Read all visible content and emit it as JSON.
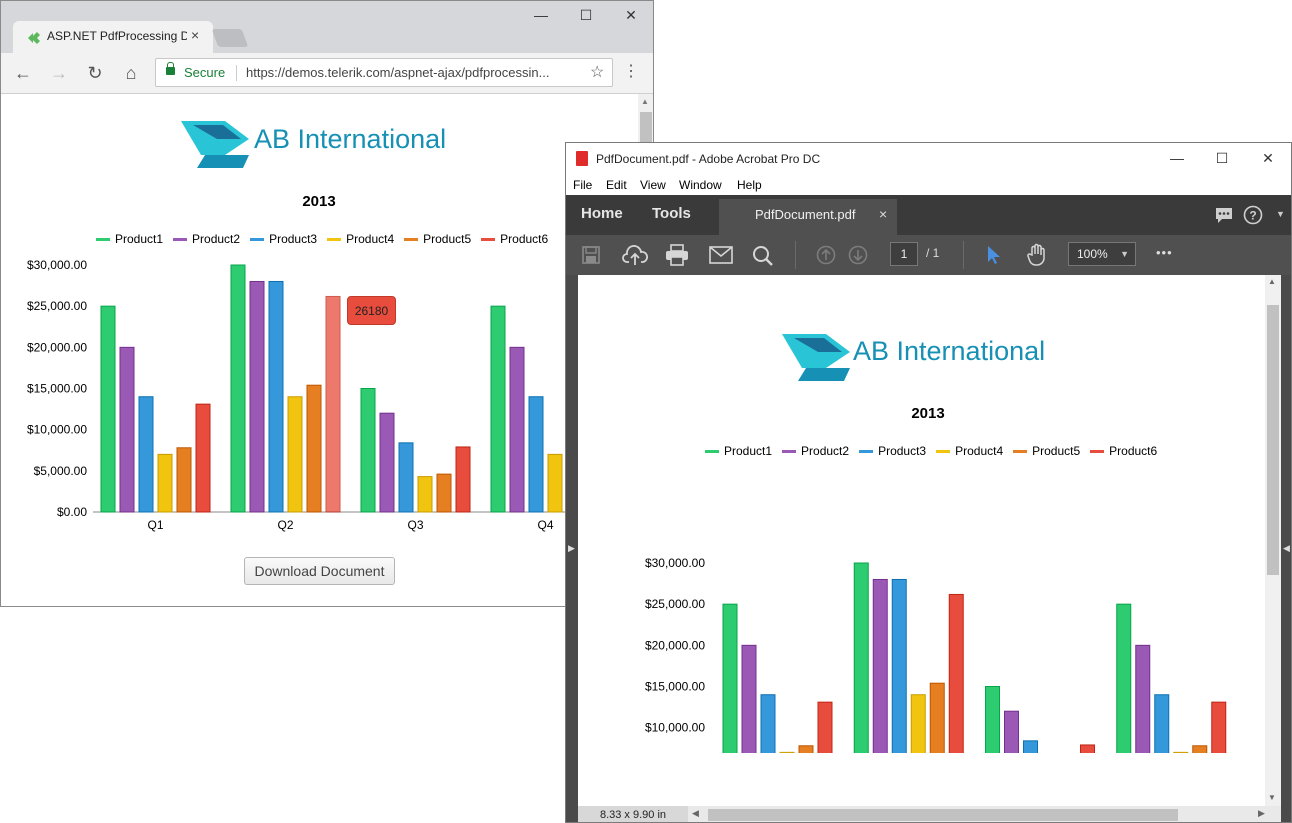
{
  "browser": {
    "tab_title": "ASP.NET PdfProcessing D",
    "tab_close": "×",
    "window_controls": {
      "minimize": "—",
      "maximize": "☐",
      "close": "✕"
    },
    "nav": {
      "back": "←",
      "forward": "→",
      "reload": "↻",
      "home": "⌂"
    },
    "secure_label": "Secure",
    "url": "https://demos.telerik.com/aspnet-ajax/pdfprocessin...",
    "bookmark_icon": "☆",
    "menu_icon": "⋮",
    "download_button": "Download Document",
    "tooltip_value": "26180"
  },
  "logo": {
    "text": "AB International",
    "colors": {
      "primary": "#1790b5",
      "accent": "#29c5d6"
    }
  },
  "acrobat": {
    "title": "PdfDocument.pdf - Adobe Acrobat Pro DC",
    "menu": [
      "File",
      "Edit",
      "View",
      "Window",
      "Help"
    ],
    "home_label": "Home",
    "tools_label": "Tools",
    "doc_tab": "PdfDocument.pdf",
    "doc_tab_close": "×",
    "page_current": "1",
    "page_total": "/ 1",
    "zoom": "100%",
    "more_icon": "•••",
    "page_size": "8.33 x 9.90 in"
  },
  "chart_data": {
    "type": "bar",
    "title": "2013",
    "categories": [
      "Q1",
      "Q2",
      "Q3",
      "Q4"
    ],
    "series": [
      {
        "name": "Product1",
        "color": "#2ecc71",
        "values": [
          25000,
          30000,
          15000,
          25000
        ]
      },
      {
        "name": "Product2",
        "color": "#9b59b6",
        "values": [
          20000,
          28000,
          12000,
          20000
        ]
      },
      {
        "name": "Product3",
        "color": "#3498db",
        "values": [
          14000,
          28000,
          8400,
          14000
        ]
      },
      {
        "name": "Product4",
        "color": "#f1c40f",
        "values": [
          7000,
          14000,
          4300,
          7000
        ]
      },
      {
        "name": "Product5",
        "color": "#e67e22",
        "values": [
          7800,
          15400,
          4600,
          7800
        ]
      },
      {
        "name": "Product6",
        "color": "#e74c3c",
        "values": [
          13100,
          26180,
          7900,
          13100
        ]
      }
    ],
    "ylim": [
      0,
      30000
    ],
    "y_ticks": [
      "$0.00",
      "$5,000.00",
      "$10,000.00",
      "$15,000.00",
      "$20,000.00",
      "$25,000.00",
      "$30,000.00"
    ],
    "legend_position": "top",
    "grid": false
  }
}
